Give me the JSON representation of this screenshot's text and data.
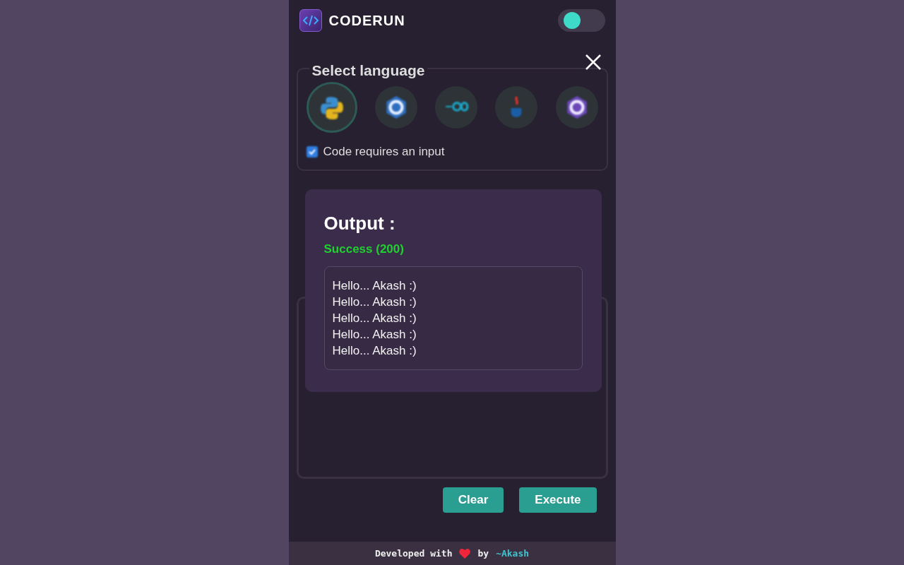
{
  "header": {
    "title": "CODERUN",
    "theme_toggle": {
      "on": false
    }
  },
  "language_panel": {
    "legend": "Select language",
    "languages": [
      {
        "kind": "python",
        "selected": true
      },
      {
        "kind": "cpp",
        "selected": false
      },
      {
        "kind": "go",
        "selected": false
      },
      {
        "kind": "java",
        "selected": false
      },
      {
        "kind": "csharp",
        "selected": false
      }
    ],
    "input_checkbox": {
      "label": "Code requires an input",
      "checked": true
    }
  },
  "buttons": [
    "Clear",
    "Execute"
  ],
  "output_dialog": {
    "title": "Output :",
    "status": "Success (200)",
    "lines": [
      "Hello... Akash :)",
      "Hello... Akash :)",
      "Hello... Akash :)",
      "Hello... Akash :)",
      "Hello... Akash :)"
    ]
  },
  "footer": {
    "text_before": "Developed with",
    "text_after": "by",
    "author": "~Akash"
  }
}
